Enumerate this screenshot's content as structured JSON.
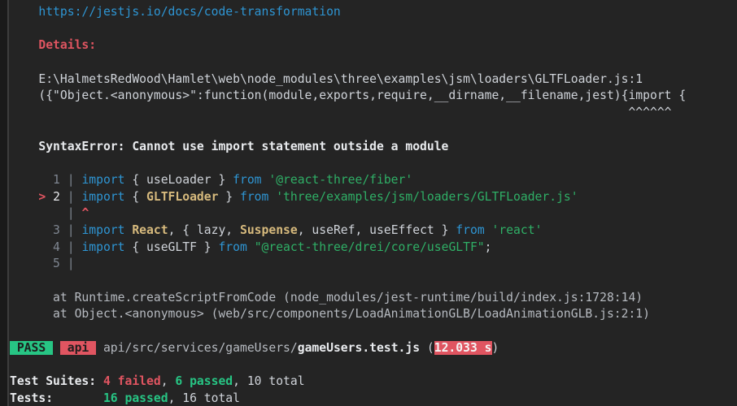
{
  "terminal": {
    "colors": {
      "bg": "#242424",
      "panelEdge": "#1a1a1a",
      "panelLine": "#3d3d3d",
      "fg": "#cfd3d9",
      "white": "#e9ebee",
      "dim": "#b6bac0",
      "grey": "#7f8691",
      "cyan": "#2e95d3",
      "red": "#e05561",
      "green": "#2faf66",
      "greenB": "#27c584",
      "yellow": "#d7ba7d",
      "badgeText": "#1e1e1e",
      "timeText": "#f4f4f4"
    },
    "lines": [
      {
        "n": "url-line",
        "tokens": [
          {
            "t": "    ",
            "c": "fg"
          },
          {
            "t": "https://jestjs.io/docs/code-transformation",
            "c": "cyan",
            "n": "docs-link",
            "i": true
          }
        ]
      },
      {
        "n": "blank-line",
        "tokens": []
      },
      {
        "n": "details-heading",
        "tokens": [
          {
            "t": "    ",
            "c": "fg"
          },
          {
            "t": "Details:",
            "c": "red bold",
            "n": "details-label"
          }
        ]
      },
      {
        "n": "blank-line",
        "tokens": []
      },
      {
        "n": "error-file-path",
        "tokens": [
          {
            "t": "    E:\\HalmetsRedWood\\Hamlet\\web\\node_modules\\three\\examples\\jsm\\loaders\\GLTFLoader.js:1",
            "c": "fg"
          }
        ]
      },
      {
        "n": "error-source-line",
        "tokens": [
          {
            "t": "    ({\"Object.<anonymous>\":function(module,exports,require,__dirname,__filename,jest){import {",
            "c": "fg"
          }
        ]
      },
      {
        "n": "caret-marker-line",
        "tokens": [
          {
            "t": "                                                                                      ^^^^^^",
            "c": "fg"
          }
        ]
      },
      {
        "n": "blank-line",
        "tokens": []
      },
      {
        "n": "syntax-error-message",
        "tokens": [
          {
            "t": "    ",
            "c": "fg"
          },
          {
            "t": "SyntaxError: Cannot use import statement outside a module",
            "c": "white bold"
          }
        ]
      },
      {
        "n": "blank-line",
        "tokens": []
      },
      {
        "n": "code-frame-line-1",
        "tokens": [
          {
            "t": "      1 | ",
            "c": "grey"
          },
          {
            "t": "import",
            "c": "cyan"
          },
          {
            "t": " { useLoader } ",
            "c": "fg"
          },
          {
            "t": "from",
            "c": "cyan"
          },
          {
            "t": " ",
            "c": "fg"
          },
          {
            "t": "'@react-three/fiber'",
            "c": "green"
          }
        ]
      },
      {
        "n": "code-frame-line-2",
        "tokens": [
          {
            "t": "    ",
            "c": "fg"
          },
          {
            "t": "> ",
            "c": "red bold"
          },
          {
            "t": "2",
            "c": "white"
          },
          {
            "t": " | ",
            "c": "grey"
          },
          {
            "t": "import",
            "c": "cyan"
          },
          {
            "t": " { ",
            "c": "fg"
          },
          {
            "t": "GLTFLoader",
            "c": "yellow"
          },
          {
            "t": " } ",
            "c": "fg"
          },
          {
            "t": "from",
            "c": "cyan"
          },
          {
            "t": " ",
            "c": "fg"
          },
          {
            "t": "'three/examples/jsm/loaders/GLTFLoader.js'",
            "c": "green"
          }
        ]
      },
      {
        "n": "code-frame-marker-line",
        "tokens": [
          {
            "t": "        ",
            "c": "fg"
          },
          {
            "t": "|",
            "c": "grey"
          },
          {
            "t": " ",
            "c": "fg"
          },
          {
            "t": "^",
            "c": "red bold"
          }
        ]
      },
      {
        "n": "code-frame-line-3",
        "tokens": [
          {
            "t": "      3 | ",
            "c": "grey"
          },
          {
            "t": "import",
            "c": "cyan"
          },
          {
            "t": " ",
            "c": "fg"
          },
          {
            "t": "React",
            "c": "yellow"
          },
          {
            "t": ", { lazy, ",
            "c": "fg"
          },
          {
            "t": "Suspense",
            "c": "yellow"
          },
          {
            "t": ", useRef, useEffect } ",
            "c": "fg"
          },
          {
            "t": "from",
            "c": "cyan"
          },
          {
            "t": " ",
            "c": "fg"
          },
          {
            "t": "'react'",
            "c": "green"
          }
        ]
      },
      {
        "n": "code-frame-line-4",
        "tokens": [
          {
            "t": "      4 | ",
            "c": "grey"
          },
          {
            "t": "import",
            "c": "cyan"
          },
          {
            "t": " { useGLTF } ",
            "c": "fg"
          },
          {
            "t": "from",
            "c": "cyan"
          },
          {
            "t": " ",
            "c": "fg"
          },
          {
            "t": "\"@react-three/drei/core/useGLTF\"",
            "c": "green"
          },
          {
            "t": ";",
            "c": "fg"
          }
        ]
      },
      {
        "n": "code-frame-line-5",
        "tokens": [
          {
            "t": "      5 |",
            "c": "grey"
          }
        ]
      },
      {
        "n": "blank-line",
        "tokens": []
      },
      {
        "n": "stack-trace-line",
        "tokens": [
          {
            "t": "      at Runtime.createScriptFromCode (node_modules/jest-runtime/build/index.js:1728:14)",
            "c": "dim"
          }
        ]
      },
      {
        "n": "stack-trace-line",
        "tokens": [
          {
            "t": "      at Object.<anonymous> (web/src/components/LoadAnimationGLB/LoadAnimationGLB.js:2:1)",
            "c": "dim"
          }
        ]
      },
      {
        "n": "blank-line",
        "tokens": []
      },
      {
        "n": "test-result-line",
        "tokens": [
          {
            "t": " PASS ",
            "c": "badge-pass",
            "n": "pass-badge"
          },
          {
            "t": " ",
            "c": "fg"
          },
          {
            "t": " api ",
            "c": "badge-api",
            "n": "project-badge"
          },
          {
            "t": " ",
            "c": "fg"
          },
          {
            "t": "api/src/services/gameUsers/",
            "c": "dim",
            "n": "test-file-dir"
          },
          {
            "t": "gameUsers.test.js",
            "c": "white bold",
            "n": "test-file-name"
          },
          {
            "t": " (",
            "c": "fg"
          },
          {
            "t": "12.033 s",
            "c": "badge-time",
            "n": "slow-time-badge"
          },
          {
            "t": ")",
            "c": "fg"
          }
        ]
      },
      {
        "n": "blank-line",
        "tokens": []
      },
      {
        "n": "test-suites-summary",
        "tokens": [
          {
            "t": "Test Suites: ",
            "c": "white bold",
            "n": "test-suites-label"
          },
          {
            "t": "4 failed",
            "c": "red bold",
            "n": "suites-failed-count"
          },
          {
            "t": ", ",
            "c": "fg"
          },
          {
            "t": "6 passed",
            "c": "greenB bold",
            "n": "suites-passed-count"
          },
          {
            "t": ", 10 total",
            "c": "fg",
            "n": "suites-total-count"
          }
        ]
      },
      {
        "n": "tests-summary",
        "tokens": [
          {
            "t": "Tests:       ",
            "c": "white bold",
            "n": "tests-label"
          },
          {
            "t": "16 passed",
            "c": "greenB bold",
            "n": "tests-passed-count"
          },
          {
            "t": ", 16 total",
            "c": "fg",
            "n": "tests-total-count"
          }
        ]
      }
    ]
  }
}
